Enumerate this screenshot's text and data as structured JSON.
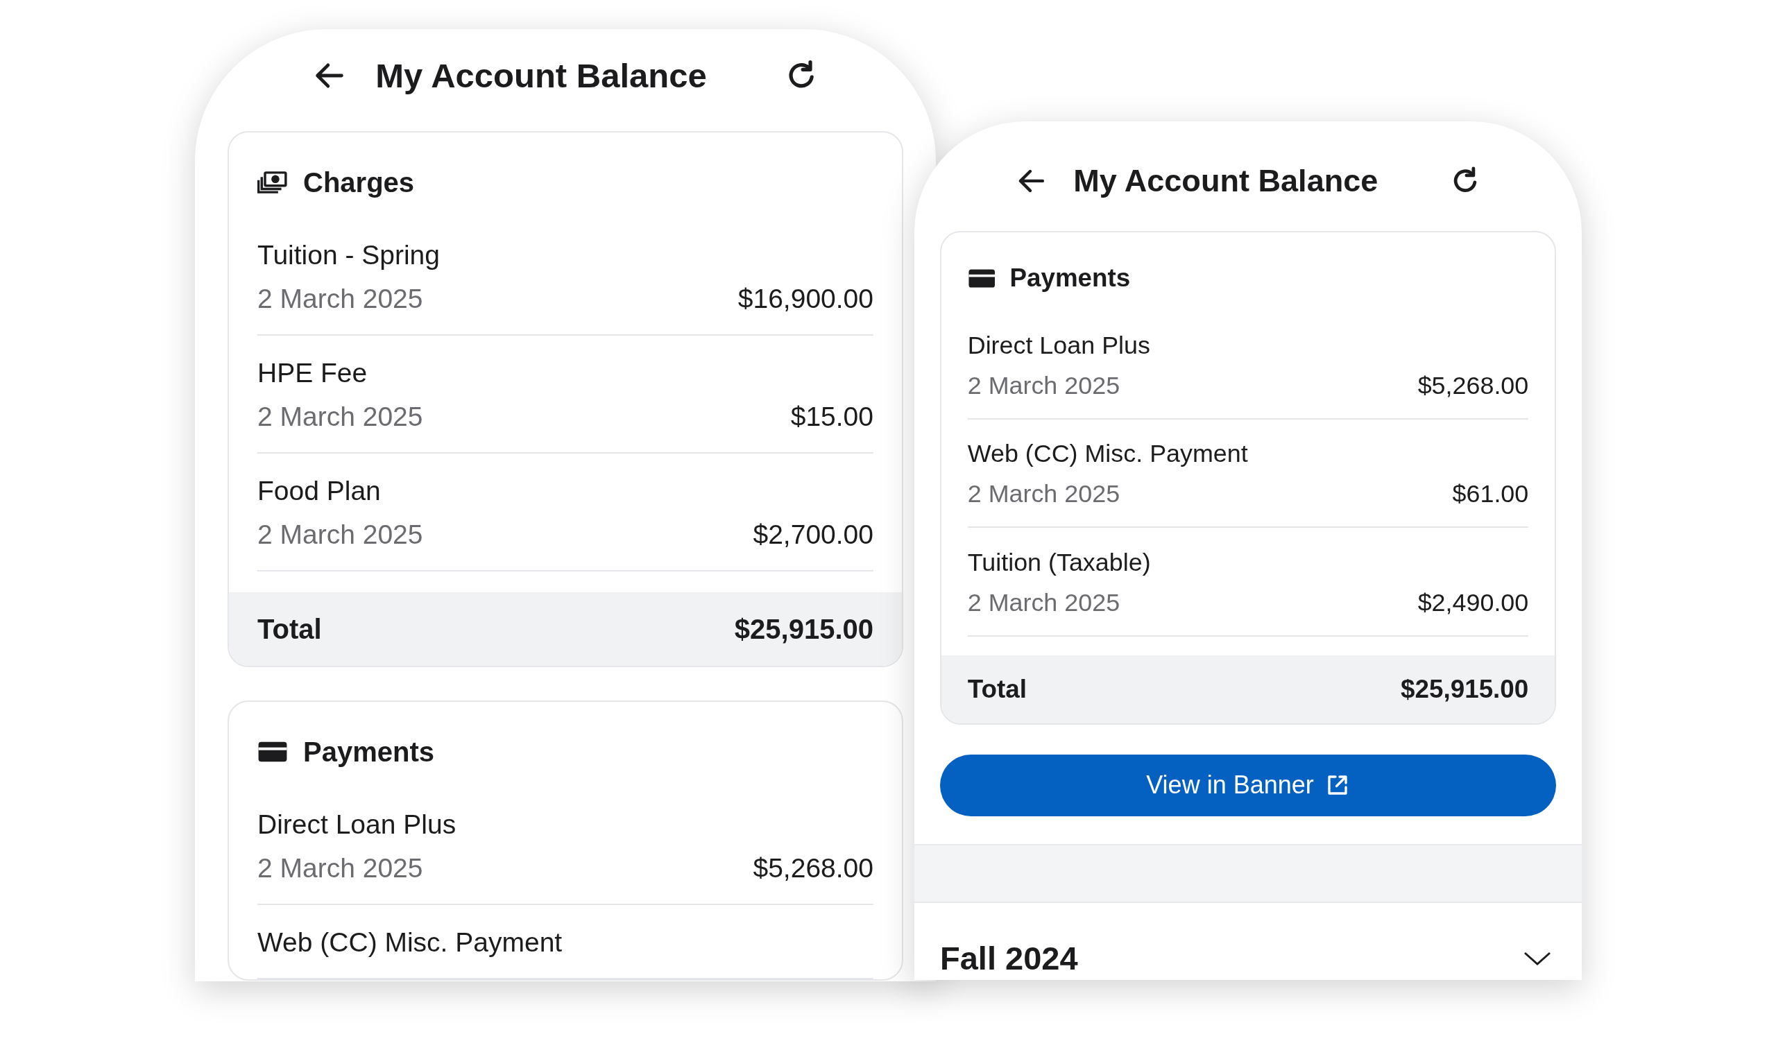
{
  "screens": [
    {
      "title": "My Account Balance",
      "sections": [
        {
          "kind": "charges",
          "title": "Charges",
          "items": [
            {
              "name": "Tuition - Spring",
              "date": "2 March 2025",
              "amount": "$16,900.00"
            },
            {
              "name": "HPE Fee",
              "date": "2 March 2025",
              "amount": "$15.00"
            },
            {
              "name": "Food Plan",
              "date": "2 March 2025",
              "amount": "$2,700.00"
            }
          ],
          "total": {
            "label": "Total",
            "amount": "$25,915.00"
          }
        },
        {
          "kind": "payments",
          "title": "Payments",
          "items": [
            {
              "name": "Direct Loan Plus",
              "date": "2 March 2025",
              "amount": "$5,268.00"
            },
            {
              "name": "Web (CC) Misc. Payment"
            }
          ]
        }
      ]
    },
    {
      "title": "My Account Balance",
      "sections": [
        {
          "kind": "payments",
          "title": "Payments",
          "items": [
            {
              "name": "Direct Loan Plus",
              "date": "2 March 2025",
              "amount": "$5,268.00"
            },
            {
              "name": "Web (CC) Misc. Payment",
              "date": "2 March 2025",
              "amount": "$61.00"
            },
            {
              "name": "Tuition (Taxable)",
              "date": "2 March 2025",
              "amount": "$2,490.00"
            }
          ],
          "total": {
            "label": "Total",
            "amount": "$25,915.00"
          }
        }
      ],
      "button": {
        "label": "View in Banner"
      },
      "term": {
        "title": "Fall 2024",
        "expanded": false
      }
    }
  ]
}
